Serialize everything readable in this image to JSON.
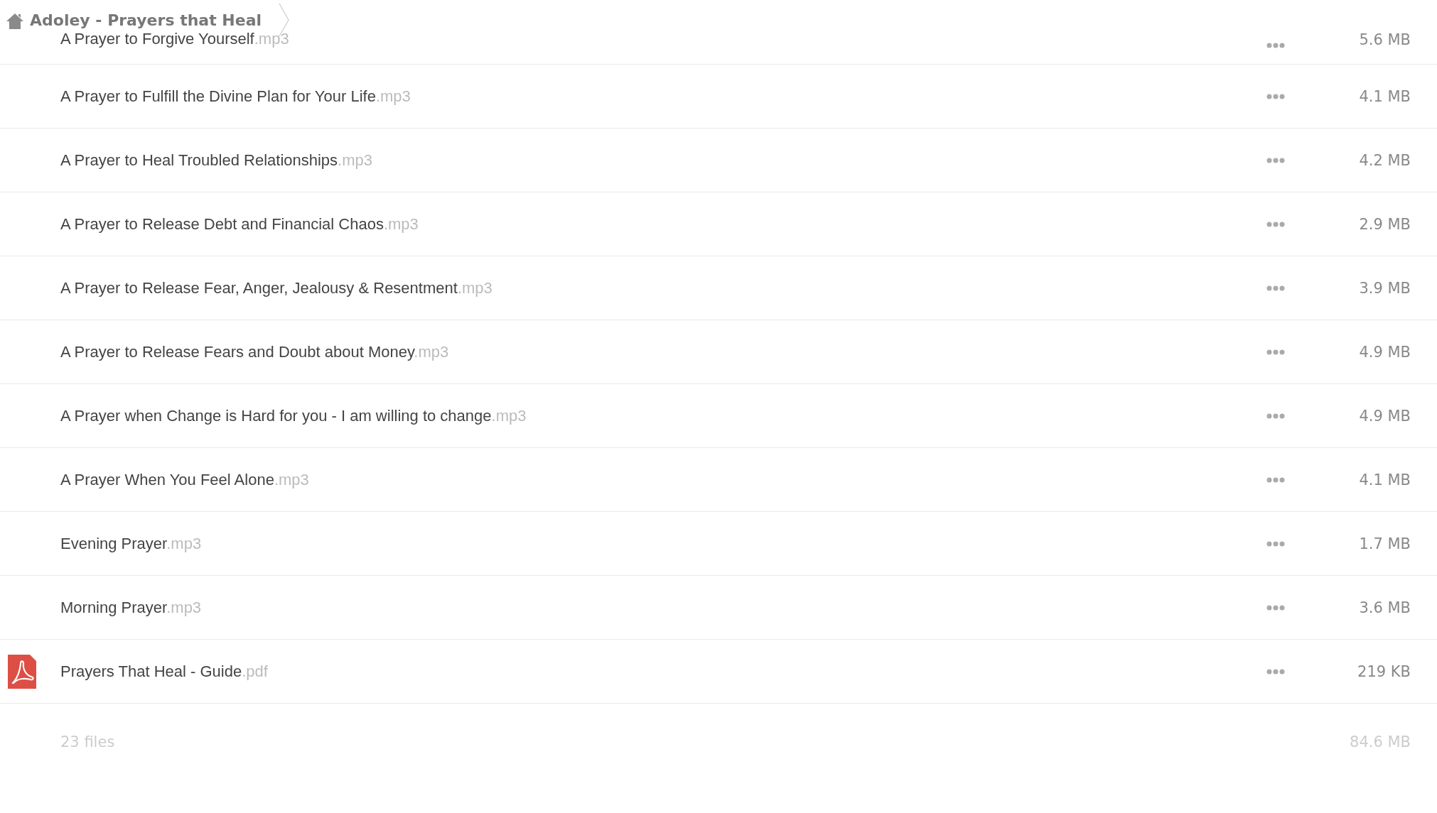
{
  "breadcrumb": {
    "title": "Adoley - Prayers that Heal"
  },
  "files": [
    {
      "name": "A Prayer to Forgive Yourself",
      "ext": ".mp3",
      "size": "5.6 MB",
      "kind": "audio"
    },
    {
      "name": "A Prayer to Fulfill the Divine Plan for Your Life",
      "ext": ".mp3",
      "size": "4.1 MB",
      "kind": "audio"
    },
    {
      "name": "A Prayer to Heal Troubled Relationships",
      "ext": ".mp3",
      "size": "4.2 MB",
      "kind": "audio"
    },
    {
      "name": "A Prayer to Release Debt and Financial Chaos",
      "ext": ".mp3",
      "size": "2.9 MB",
      "kind": "audio"
    },
    {
      "name": "A Prayer to Release Fear, Anger, Jealousy & Resentment",
      "ext": ".mp3",
      "size": "3.9 MB",
      "kind": "audio"
    },
    {
      "name": "A Prayer to Release Fears and Doubt about Money",
      "ext": ".mp3",
      "size": "4.9 MB",
      "kind": "audio"
    },
    {
      "name": "A Prayer when Change is Hard for you - I am willing to change",
      "ext": ".mp3",
      "size": "4.9 MB",
      "kind": "audio"
    },
    {
      "name": "A Prayer When You Feel Alone",
      "ext": ".mp3",
      "size": "4.1 MB",
      "kind": "audio"
    },
    {
      "name": "Evening Prayer",
      "ext": ".mp3",
      "size": "1.7 MB",
      "kind": "audio"
    },
    {
      "name": "Morning Prayer",
      "ext": ".mp3",
      "size": "3.6 MB",
      "kind": "audio"
    },
    {
      "name": "Prayers That Heal - Guide",
      "ext": ".pdf",
      "size": "219 KB",
      "kind": "pdf"
    }
  ],
  "footer": {
    "count": "23 files",
    "total": "84.6 MB"
  }
}
